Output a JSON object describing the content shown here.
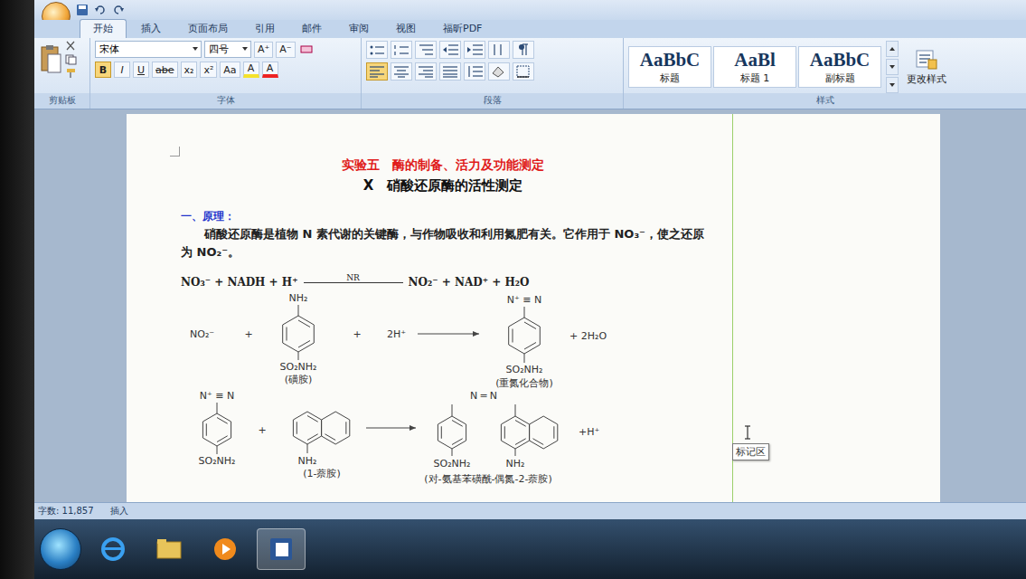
{
  "tabs": [
    {
      "label": "开始",
      "selected": true
    },
    {
      "label": "插入",
      "selected": false
    },
    {
      "label": "页面布局",
      "selected": false
    },
    {
      "label": "引用",
      "selected": false
    },
    {
      "label": "邮件",
      "selected": false
    },
    {
      "label": "审阅",
      "selected": false
    },
    {
      "label": "视图",
      "selected": false
    },
    {
      "label": "福昕PDF",
      "selected": false
    }
  ],
  "ribbon": {
    "groups": [
      {
        "label": "剪贴板"
      },
      {
        "label": "字体"
      },
      {
        "label": "段落"
      },
      {
        "label": "样式"
      }
    ],
    "font": {
      "name": "宋体",
      "size": "四号",
      "size_buttons": [
        "A⁺",
        "A⁻"
      ],
      "buttons": [
        {
          "label": "B",
          "kind": "bold"
        },
        {
          "label": "I",
          "kind": "italic"
        },
        {
          "label": "U",
          "kind": "underline"
        },
        {
          "label": "abe",
          "kind": "strike"
        },
        {
          "label": "x₂",
          "kind": "sub"
        },
        {
          "label": "x²",
          "kind": "sup"
        },
        {
          "label": "Aa",
          "kind": "case"
        },
        {
          "label": "A",
          "kind": "highlight"
        },
        {
          "label": "A",
          "kind": "color"
        }
      ]
    },
    "paragraph": {
      "align": [
        {
          "selected": true
        },
        {
          "selected": false
        },
        {
          "selected": false
        },
        {
          "selected": false
        }
      ]
    },
    "styles": [
      {
        "sample": "AaBbC",
        "label": "标题"
      },
      {
        "sample": "AaBl",
        "label": "标题 1"
      },
      {
        "sample": "AaBbC",
        "label": "副标题"
      }
    ],
    "change_styles": "更改样式"
  },
  "document": {
    "heading": "实验五　酶的制备、活力及功能测定",
    "subheading": "X　硝酸还原酶的活性测定",
    "section": "一、原理：",
    "paragraph": "硝酸还原酶是植物 N 素代谢的关键酶，与作物吸收和利用氮肥有关。它作用于 NO₃⁻，使之还原为 NO₂⁻。",
    "equation": {
      "left": "NO₃⁻ + NADH + H⁺",
      "enzyme": "NR",
      "right": "NO₂⁻  + NAD⁺  + H₂O"
    },
    "reaction1": {
      "nitrite": "NO₂⁻",
      "plus1": "+",
      "amine": "NH₂",
      "sulfonamide": "SO₂NH₂",
      "name": "(磺胺)",
      "plus2": "+",
      "protons": "2H⁺",
      "diazo": "N⁺ ≡ N",
      "sulfonamide2": "SO₂NH₂",
      "product_name": "(重氮化合物)",
      "water": "+ 2H₂O"
    },
    "reaction2": {
      "diazo": "N⁺ ≡ N",
      "sulfonamide": "SO₂NH₂",
      "plus": "+",
      "amine": "NH₂",
      "name": "(1-萘胺)",
      "azo": "N ═ N",
      "sulfonamide2": "SO₂NH₂",
      "amine2": "NH₂",
      "proton": "+H⁺",
      "product_name": "(对-氨基苯磺酰-偶氮-2-萘胺)"
    }
  },
  "tooltip": "标记区",
  "status_bar": {
    "words": "字数: 11,857",
    "mode": "插入"
  },
  "taskbar": [
    {
      "kind": "ie",
      "selected": false
    },
    {
      "kind": "folder",
      "selected": false
    },
    {
      "kind": "media",
      "selected": false
    },
    {
      "kind": "word",
      "selected": true
    }
  ]
}
